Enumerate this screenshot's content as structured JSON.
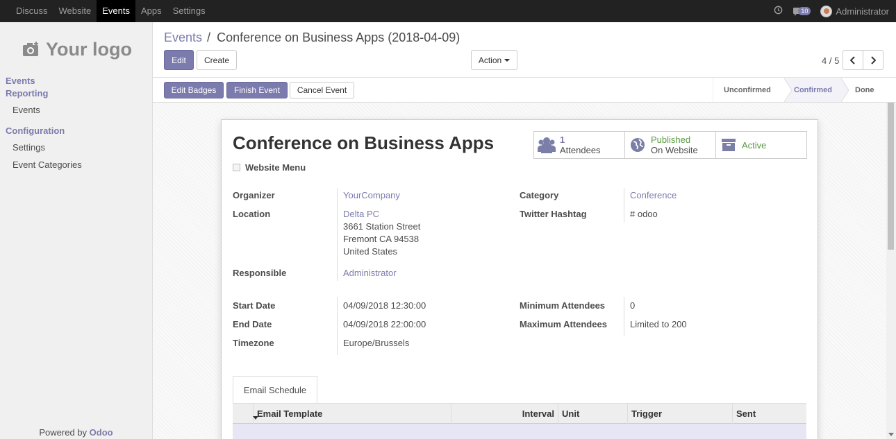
{
  "topbar": {
    "menus": [
      "Discuss",
      "Website",
      "Events",
      "Apps",
      "Settings"
    ],
    "active_menu": "Events",
    "messages_count": "10",
    "user": "Administrator"
  },
  "sidebar": {
    "logo_text": "Your logo",
    "section1": "Events",
    "section2": "Reporting",
    "item_events": "Events",
    "section3": "Configuration",
    "item_settings": "Settings",
    "item_categories": "Event Categories",
    "powered_prefix": "Powered by",
    "powered_brand": "Odoo"
  },
  "control_panel": {
    "breadcrumb_parent": "Events",
    "breadcrumb_sep": "/",
    "breadcrumb_current": "Conference on Business Apps (2018-04-09)",
    "edit_label": "Edit",
    "create_label": "Create",
    "action_label": "Action",
    "pager": "4 / 5"
  },
  "statusbar": {
    "buttons": [
      "Edit Badges",
      "Finish Event",
      "Cancel Event"
    ],
    "stages": [
      "Unconfirmed",
      "Confirmed",
      "Done"
    ],
    "current_stage": "Confirmed"
  },
  "form": {
    "title": "Conference on Business Apps",
    "website_menu_label": "Website Menu",
    "smart_buttons": {
      "attendees_count": "1",
      "attendees_label": "Attendees",
      "published_label": "Published",
      "published_sub": "On Website",
      "active_label": "Active"
    },
    "fields": {
      "organizer_label": "Organizer",
      "organizer_value": "YourCompany",
      "location_label": "Location",
      "location_name": "Delta PC",
      "location_street": "3661 Station Street",
      "location_city": "Fremont CA 94538",
      "location_country": "United States",
      "responsible_label": "Responsible",
      "responsible_value": "Administrator",
      "category_label": "Category",
      "category_value": "Conference",
      "hashtag_label": "Twitter Hashtag",
      "hashtag_value": "# odoo",
      "start_label": "Start Date",
      "start_value": "04/09/2018 12:30:00",
      "end_label": "End Date",
      "end_value": "04/09/2018 22:00:00",
      "tz_label": "Timezone",
      "tz_value": "Europe/Brussels",
      "min_label": "Minimum Attendees",
      "min_value": "0",
      "max_label": "Maximum Attendees",
      "max_value": "Limited to 200"
    },
    "tab_label": "Email Schedule",
    "table_headers": [
      "Email Template",
      "Interval",
      "Unit",
      "Trigger",
      "Sent"
    ]
  },
  "colors": {
    "primary": "#7c7bad",
    "active_green": "#5a9a42",
    "topbar": "#222222"
  }
}
